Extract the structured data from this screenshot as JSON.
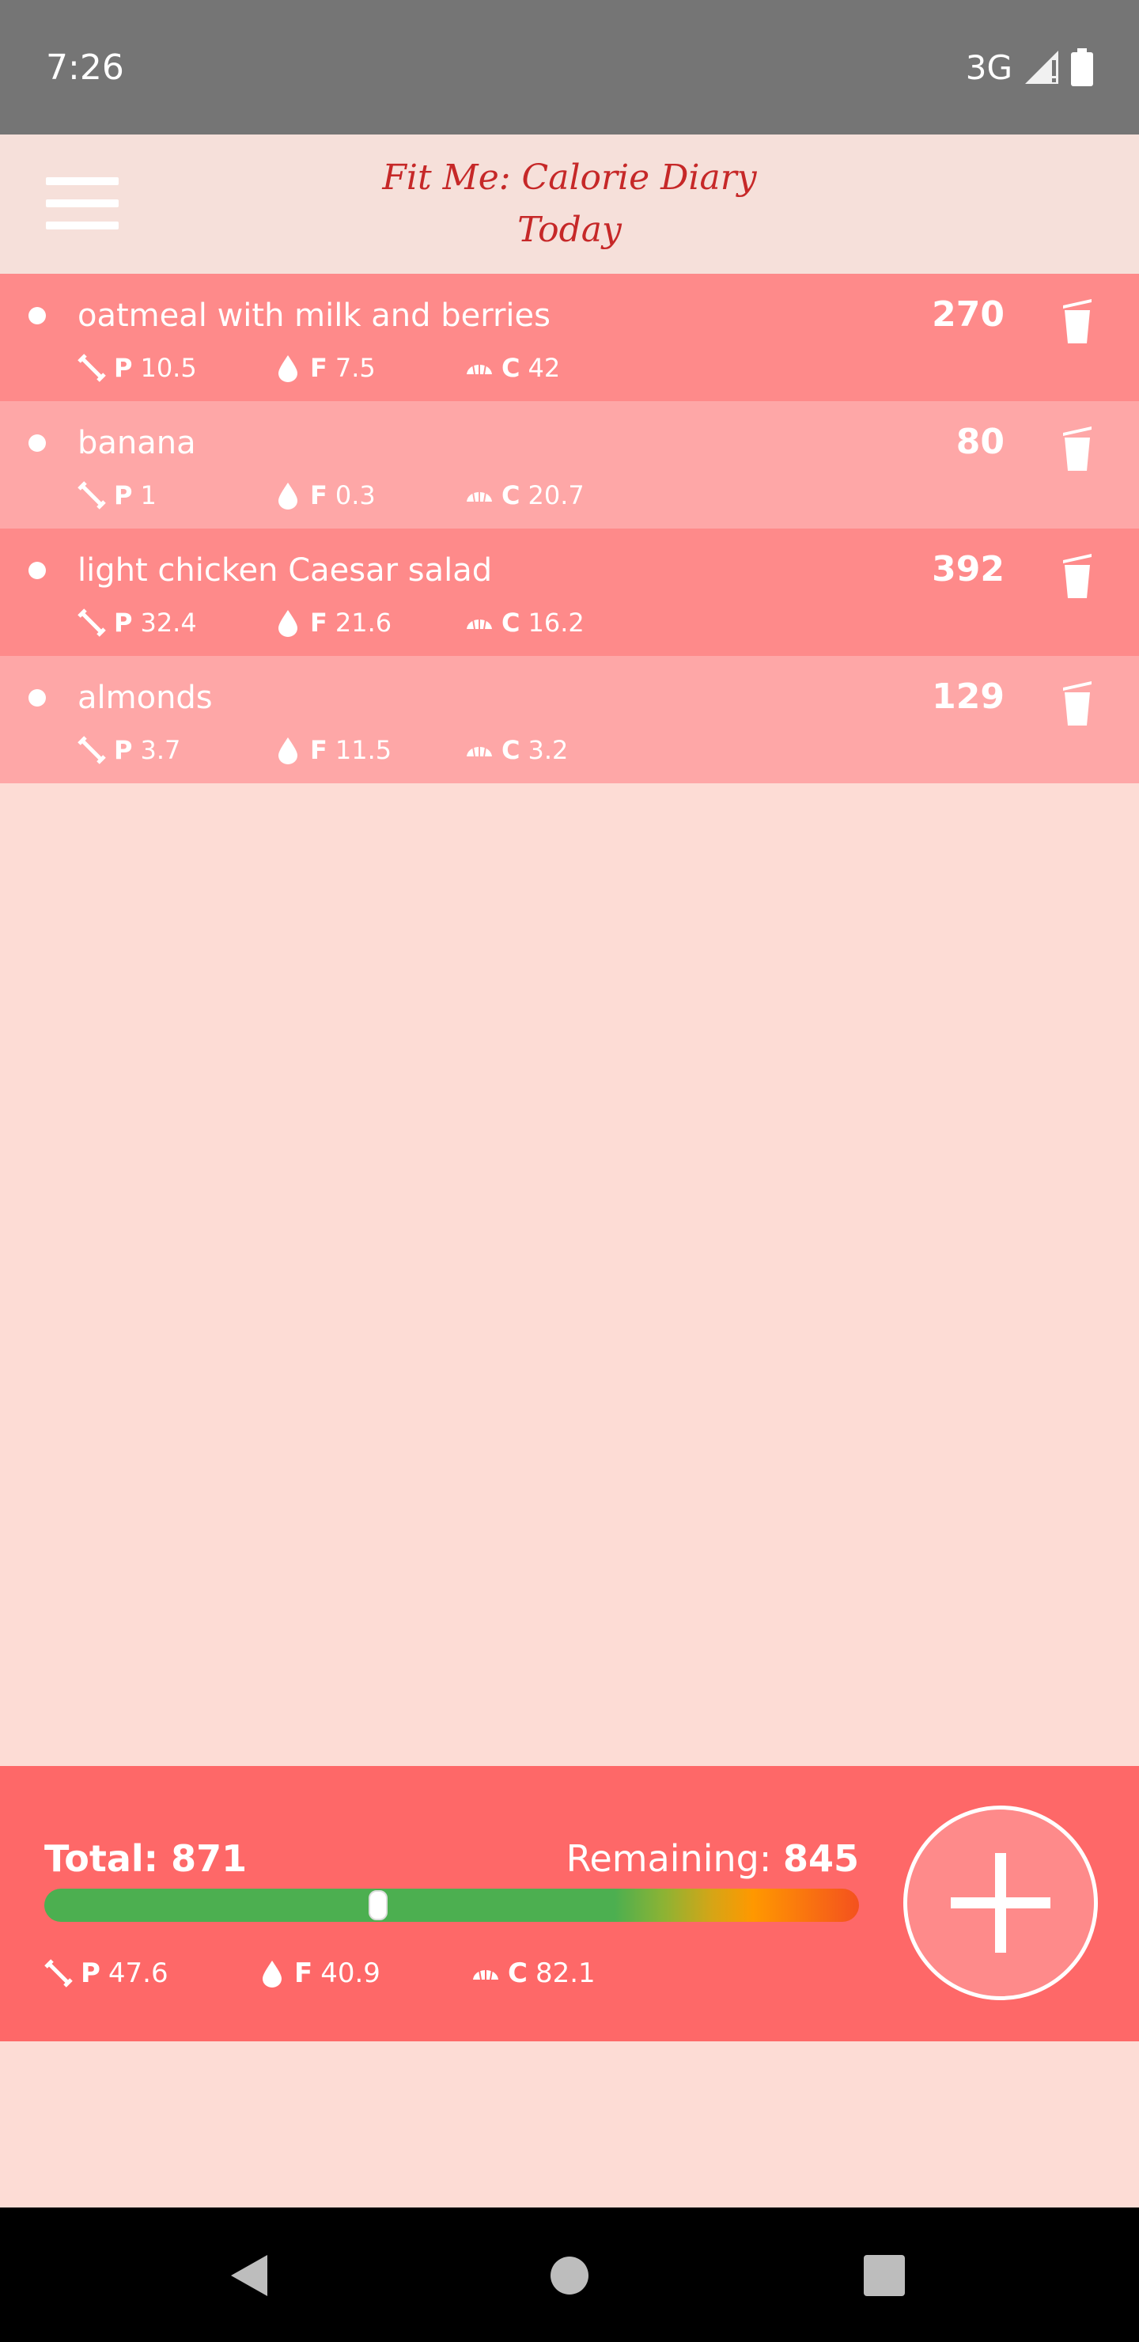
{
  "status_bar": {
    "time": "7:26",
    "network": "3G"
  },
  "app_bar": {
    "title": "Fit Me: Calorie Diary",
    "subtitle": "Today"
  },
  "entries": [
    {
      "name": "oatmeal with milk and berries",
      "calories": "270",
      "protein": "10.5",
      "fat": "7.5",
      "carbs": "42"
    },
    {
      "name": "banana",
      "calories": "80",
      "protein": "1",
      "fat": "0.3",
      "carbs": "20.7"
    },
    {
      "name": "light chicken Caesar salad",
      "calories": "392",
      "protein": "32.4",
      "fat": "21.6",
      "carbs": "16.2"
    },
    {
      "name": "almonds",
      "calories": "129",
      "protein": "3.7",
      "fat": "11.5",
      "carbs": "3.2"
    }
  ],
  "macro_letters": {
    "protein": "P",
    "fat": "F",
    "carbs": "C"
  },
  "summary": {
    "total_label": "Total:",
    "total_value": "871",
    "remaining_label": "Remaining:",
    "remaining_value": "845",
    "progress_fraction": 0.41,
    "protein": "47.6",
    "fat": "40.9",
    "carbs": "82.1"
  },
  "icons": {
    "menu": "hamburger-menu-icon",
    "delete": "trash-icon",
    "protein": "dumbbell-icon",
    "fat": "drop-icon",
    "carbs": "bread-icon",
    "add": "plus-icon"
  },
  "colors": {
    "row_odd": "#fe8a8a",
    "row_even": "#fea7a7",
    "summary_bg": "#fe6868",
    "title": "#c62828",
    "background": "#fddcd5"
  }
}
